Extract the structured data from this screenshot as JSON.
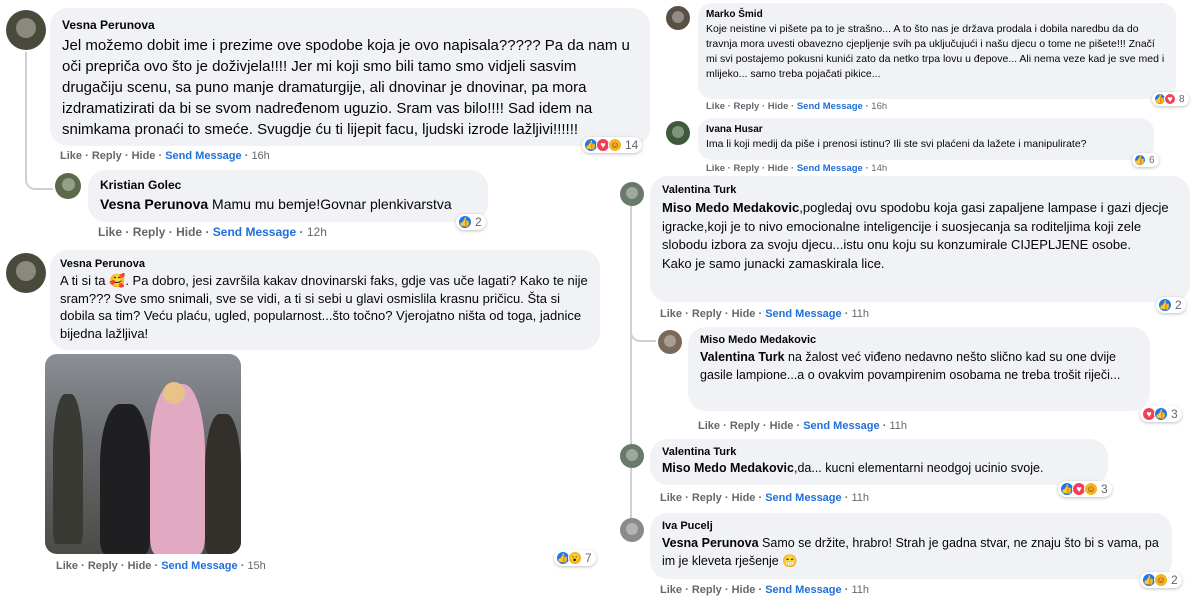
{
  "actions": {
    "like": "Like",
    "reply": "Reply",
    "hide": "Hide",
    "send": "Send Message",
    "sep": "·"
  },
  "left": {
    "c1": {
      "author": "Vesna Perunova",
      "text": "Jel možemo dobit ime i prezime ove spodobe koja je ovo napisala????? Pa da nam u oči prepriča ovo što je doživjela!!!! Jer mi koji smo bili tamo smo vidjeli sasvim drugačiju scenu, sa puno manje dramaturgije, ali dnovinar je dnovinar, pa mora izdramatizirati da bi se svom nadređenom uguzio. Sram vas bilo!!!! Sad idem na snimkama pronaći to smeće. Svugdje ću ti lijepit facu, ljudski izrode lažljivi!!!!!!",
      "time": "16h",
      "reactions": "14"
    },
    "c2": {
      "author": "Kristian Golec",
      "mention": "Vesna Perunova",
      "text": " Mamu mu bemje!Govnar plenkivarstva",
      "time": "12h",
      "reactions": "2"
    },
    "c3": {
      "author": "Vesna Perunova",
      "text": "A ti si ta 🥰. Pa dobro, jesi završila kakav dnovinarski faks, gdje vas uče lagati? Kako te nije sram??? Sve smo snimali, sve se vidi, a ti si sebi u glavi osmislila krasnu pričicu. Šta si dobila sa tim? Veću plaću, ugled, popularnost...što točno? Vjerojatno ništa od toga, jadnice bijedna lažljiva!",
      "time": "15h",
      "reactions": "7"
    }
  },
  "right": {
    "c1": {
      "author": "Marko Šmid",
      "text": "Koje neistine vi pišete pa to je strašno... A to što nas je država prodala i dobila naredbu da do travnja mora uvesti obavezno cjepljenje svih pa uključujući i našu djecu o tome ne pišete!!! Značí mi svi postajemo pokusni kunići zato da netko trpa lovu u đepove... Ali nema veze kad je sve med i mlijeko... samo treba pojačati pikice...",
      "time": "16h",
      "reactions": "8"
    },
    "c2": {
      "author": "Ivana Husar",
      "text": "Ima li koji medij da piše i prenosi istinu? Ili ste svi plaćeni da lažete i manipulirate?",
      "time": "14h",
      "reactions": "6"
    },
    "c3": {
      "author": "Valentina Turk",
      "mention": "Miso Medo Medakovic",
      "text": ",pogledaj ovu spodobu koja gasi zapaljene lampase i gazi djecje igracke,koji je to nivo emocionalne inteligencije i suosjecanja sa roditeljima koji zele slobodu izbora za svoju djecu...istu onu koju su konzumirale CIJEPLJENE osobe.",
      "text2": "Kako je samo junacki zamaskirala lice.",
      "time": "11h",
      "reactions": "2"
    },
    "c4": {
      "author": "Miso Medo Medakovic",
      "mention": "Valentina Turk",
      "text": " na žalost već viđeno nedavno nešto slično kad su one dvije gasile lampione...a o ovakvim povampirenim osobama ne treba trošit riječi...",
      "time": "11h",
      "reactions": "3"
    },
    "c5": {
      "author": "Valentina Turk",
      "mention": "Miso Medo Medakovic",
      "text": ",da... kucni elementarni neodgoj ucinio svoje.",
      "time": "11h",
      "reactions": "3"
    },
    "c6": {
      "author": "Iva Pucelj",
      "mention": "Vesna Perunova",
      "text": " Samo se držite, hrabro! Strah je gadna stvar, ne znaju što bi s vama, pa im je kleveta rješenje 😁",
      "time": "11h",
      "reactions": "2"
    }
  },
  "colors": {
    "bubble": "#f0f2f5",
    "link": "#216fdb",
    "meta": "#65676b",
    "like": "#1877f2",
    "love": "#f33e58"
  }
}
